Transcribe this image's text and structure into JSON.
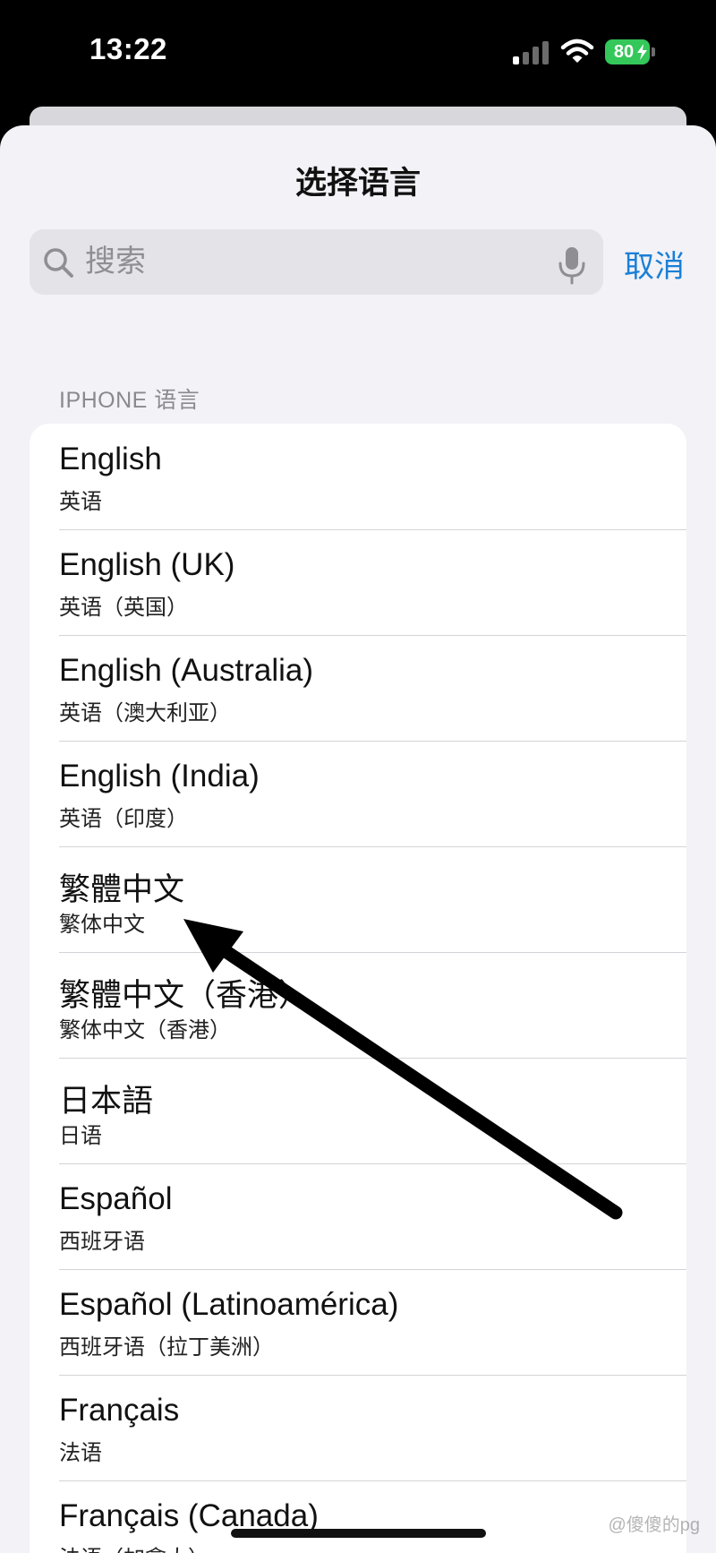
{
  "status_bar": {
    "time": "13:22",
    "battery": "80",
    "icons": [
      "signal-icon",
      "wifi-icon",
      "battery-icon"
    ]
  },
  "sheet": {
    "title": "选择语言"
  },
  "search": {
    "placeholder": "搜索",
    "value": "",
    "cancel_label": "取消"
  },
  "section": {
    "header": "IPHONE 语言"
  },
  "languages": [
    {
      "title": "English",
      "subtitle": "英语"
    },
    {
      "title": "English (UK)",
      "subtitle": "英语（英国）"
    },
    {
      "title": "English (Australia)",
      "subtitle": "英语（澳大利亚）"
    },
    {
      "title": "English (India)",
      "subtitle": "英语（印度）"
    },
    {
      "title": "繁體中文",
      "subtitle": "繁体中文"
    },
    {
      "title": "繁體中文（香港）",
      "subtitle": "繁体中文（香港）"
    },
    {
      "title": "日本語",
      "subtitle": "日语"
    },
    {
      "title": "Español",
      "subtitle": "西班牙语"
    },
    {
      "title": "Español (Latinoamérica)",
      "subtitle": "西班牙语（拉丁美洲）"
    },
    {
      "title": "Français",
      "subtitle": "法语"
    },
    {
      "title": "Français (Canada)",
      "subtitle": "法语（加拿大）"
    }
  ],
  "watermark": "@傻傻的pg",
  "colors": {
    "accent": "#1a7fd6",
    "battery": "#34c759",
    "background": "#f2f2f7"
  }
}
